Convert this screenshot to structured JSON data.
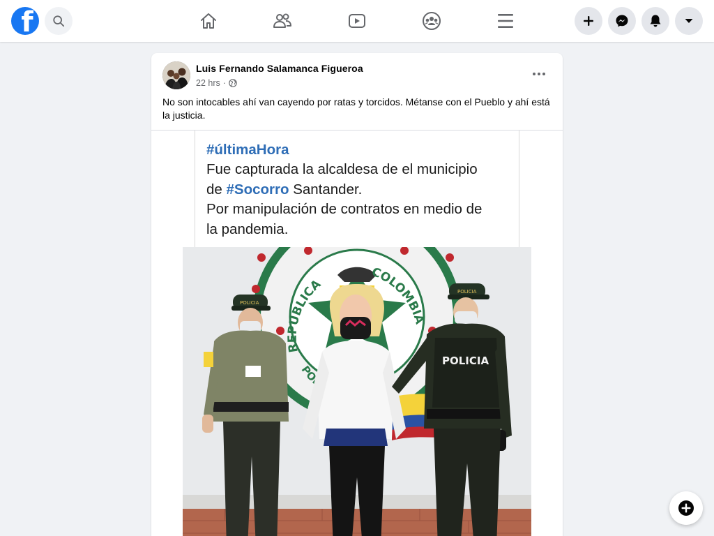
{
  "header": {
    "logo_letter": "f",
    "nav": [
      {
        "name": "home",
        "icon": "home-icon"
      },
      {
        "name": "friends",
        "icon": "friends-icon"
      },
      {
        "name": "watch",
        "icon": "video-icon"
      },
      {
        "name": "groups",
        "icon": "groups-icon"
      },
      {
        "name": "menu",
        "icon": "hamburger-menu-icon"
      }
    ],
    "right_buttons": [
      "plus-icon",
      "messenger-icon",
      "notifications-bell-icon",
      "caret-down-icon"
    ]
  },
  "post": {
    "author": "Luis Fernando Salamanca Figueroa",
    "time": "22 hrs",
    "separator": "·",
    "privacy_icon": "globe-icon",
    "text": "No son intocables ahí van cayendo por ratas y torcidos. Métanse con el Pueblo y ahí está la justicia.",
    "image": {
      "hashtag": "#últimaHora",
      "line1": "Fue capturada la alcaldesa de el municipio",
      "line2_prefix": "de ",
      "line2_hashtag": "#Socorro",
      "line2_suffix": " Santander.",
      "line3": "Por manipulación de contratos en medio de",
      "line4": "la pandemia.",
      "emblem_text_left": "REPUBLICA",
      "emblem_text_right": "COLOMBIA",
      "emblem_text_bottom": "POLICIA NACIONAL",
      "vest_label": "POLICIA",
      "cap_label": "POLICIA"
    }
  },
  "colors": {
    "brand": "#1877f2",
    "background": "#f0f2f5",
    "hashtag_blue": "#2e6db6",
    "secondary_text": "#65676b"
  }
}
